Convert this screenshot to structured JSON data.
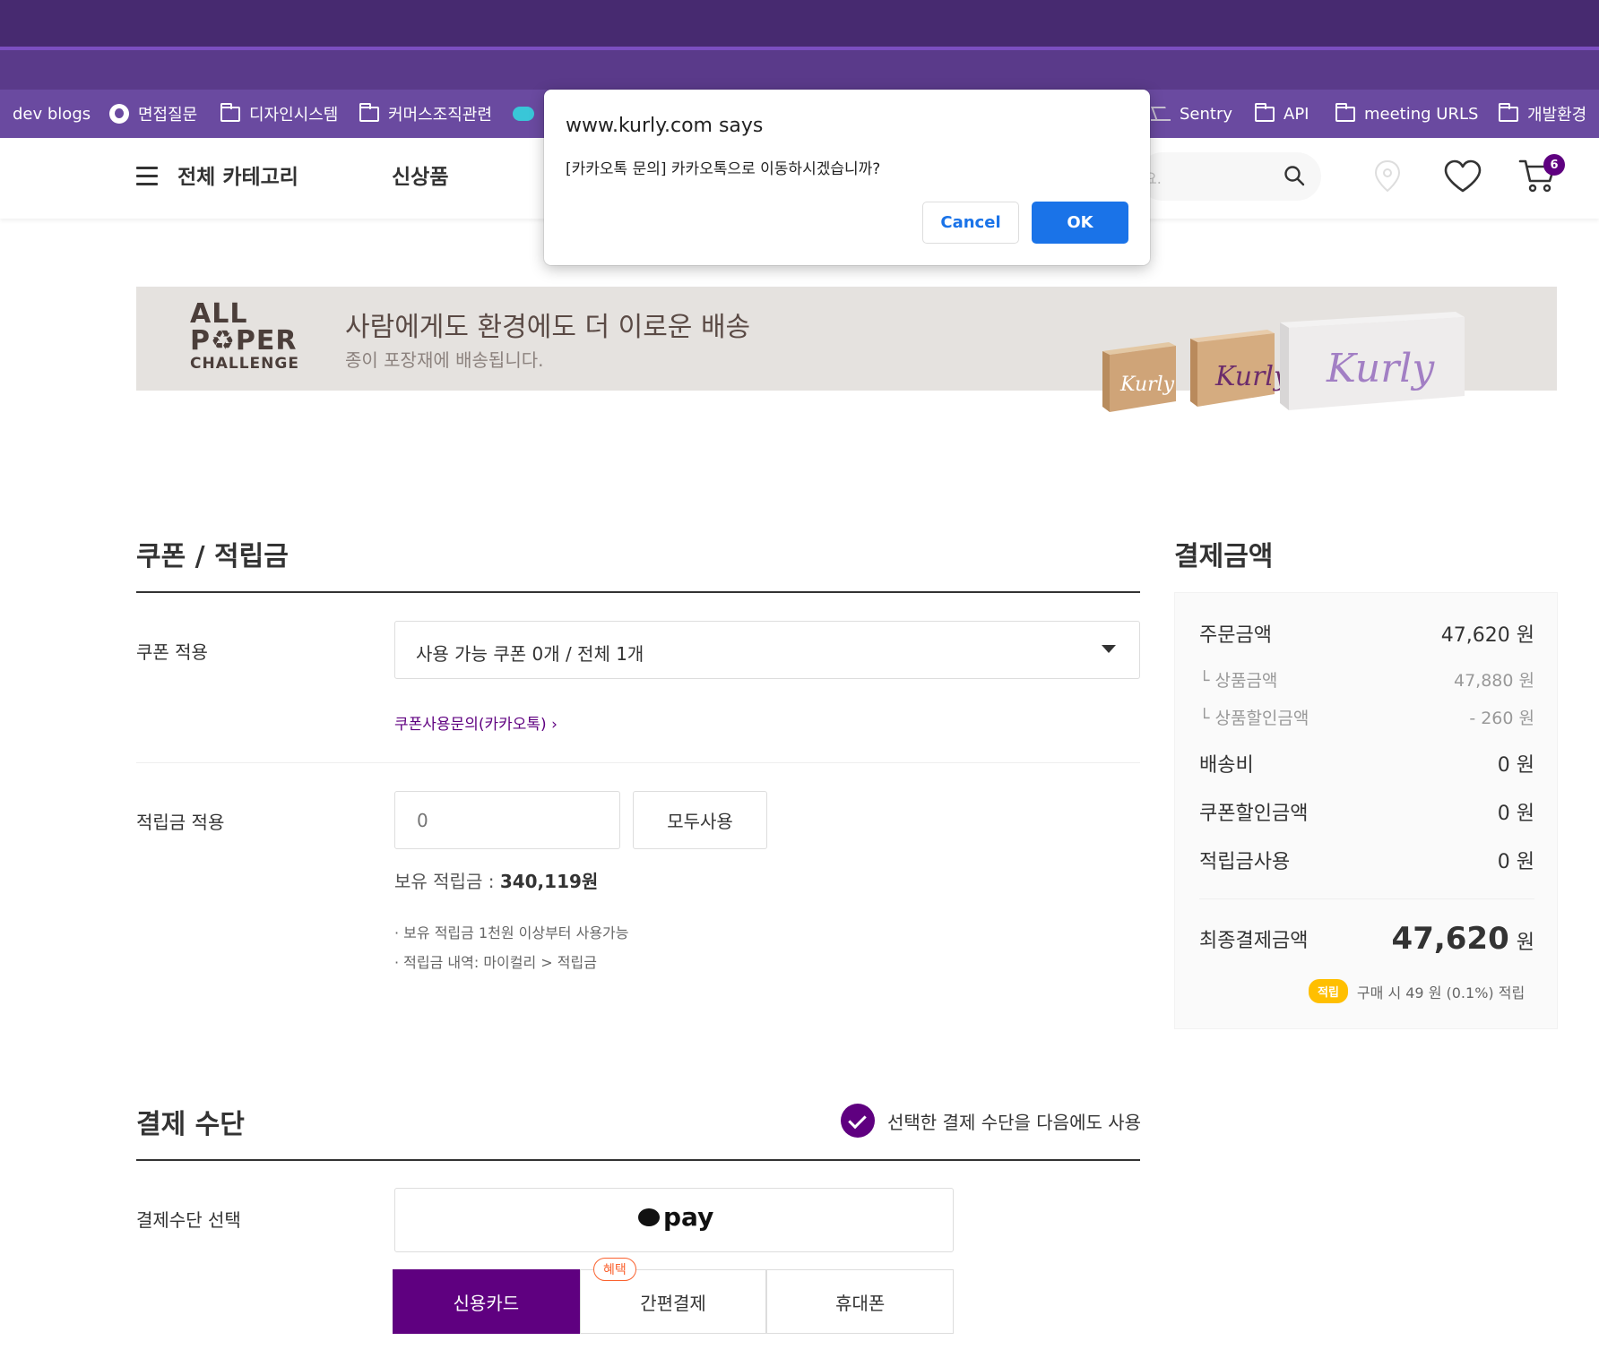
{
  "bookmarks": [
    {
      "label": "dev blogs",
      "icon": "none"
    },
    {
      "label": "면접질문",
      "icon": "github-icon"
    },
    {
      "label": "디자인시스템",
      "icon": "folder-icon"
    },
    {
      "label": "커머스조직관련",
      "icon": "folder-icon"
    },
    {
      "label": "Sentry",
      "icon": "sentry-icon"
    },
    {
      "label": "API",
      "icon": "folder-icon"
    },
    {
      "label": "meeting URLS",
      "icon": "folder-icon"
    },
    {
      "label": "개발환경",
      "icon": "folder-icon"
    }
  ],
  "header": {
    "category_label": "전체 카테고리",
    "nav_new": "신상품",
    "search_placeholder_fragment": "요.",
    "cart_count": "6"
  },
  "banner": {
    "logo_line1": "ALL",
    "logo_line2": "P♻PER",
    "logo_line3": "CHALLENGE",
    "title": "사람에게도 환경에도 더 이로운 배송",
    "subtitle": "종이 포장재에 배송됩니다."
  },
  "coupon_section": {
    "title": "쿠폰 / 적립금",
    "coupon_label": "쿠폰 적용",
    "coupon_select_value": "사용 가능 쿠폰 0개 / 전체 1개",
    "coupon_link": "쿠폰사용문의(카카오톡)",
    "points_label": "적립금 적용",
    "points_placeholder": "0",
    "use_all_button": "모두사용",
    "owned_prefix": "보유 적립금 : ",
    "owned_value": "340,119원",
    "note1": "· 보유 적립금 1천원 이상부터 사용가능",
    "note2": "· 적립금 내역: 마이컬리 > 적립금"
  },
  "summary": {
    "title": "결제금액",
    "rows": [
      {
        "label": "주문금액",
        "value": "47,620 원"
      },
      {
        "label": "└  상품금액",
        "value": "47,880 원"
      },
      {
        "label": "└  상품할인금액",
        "value": "-  260 원"
      },
      {
        "label": "배송비",
        "value": "0 원"
      },
      {
        "label": "쿠폰할인금액",
        "value": "0 원"
      },
      {
        "label": "적립금사용",
        "value": "0 원"
      }
    ],
    "final_label": "최종결제금액",
    "final_value": "47,620",
    "final_unit": "원",
    "earn_badge": "적립",
    "earn_text": "구매 시 49 원 (0.1%) 적립"
  },
  "payment": {
    "title": "결제 수단",
    "reuse_label": "선택한 결제 수단을 다음에도 사용",
    "select_label": "결제수단 선택",
    "kakaopay_label": "pay",
    "methods": [
      "신용카드",
      "간편결제",
      "휴대폰"
    ],
    "benefit_badge": "혜택"
  },
  "dialog": {
    "origin": "www.kurly.com says",
    "message": "[카카오톡 문의] 카카오톡으로 이동하시겠습니까?",
    "cancel": "Cancel",
    "ok": "OK"
  },
  "colors": {
    "brand_purple": "#5f0080",
    "chrome_purple": "#472a70",
    "dialog_blue": "#1a73e8",
    "benefit_orange": "#fa622f",
    "earn_yellow": "#ffbf00"
  }
}
